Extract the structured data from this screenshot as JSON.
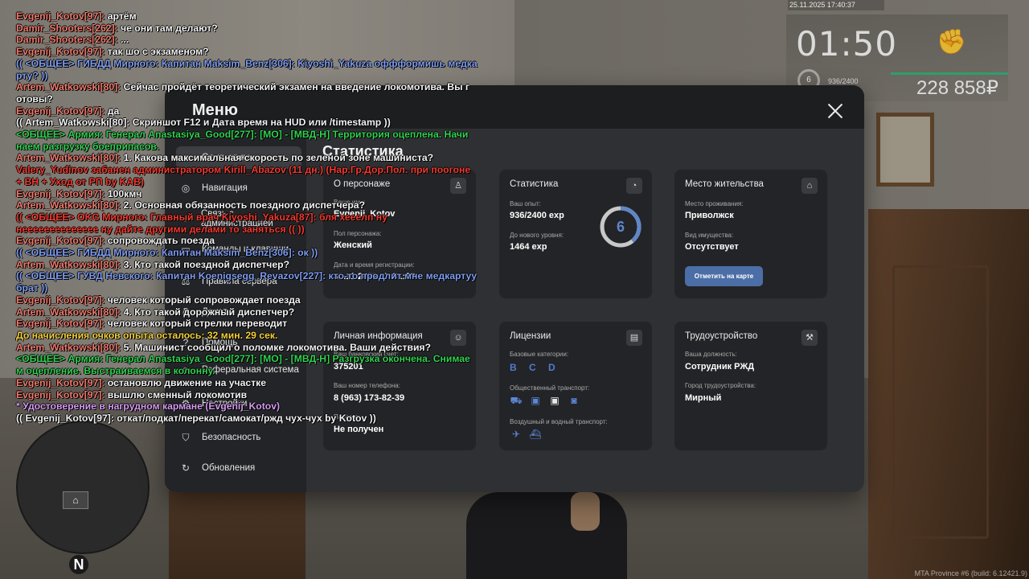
{
  "hud": {
    "datetime": "25.11.2025 17:40:37",
    "time": "01:50",
    "level": "6",
    "exp": "936/2400",
    "money": "228 858₽",
    "build_info": "MTA Province #6 (build: 6.12421.9)"
  },
  "minimap": {
    "north_label": "N"
  },
  "menu": {
    "title": "Меню",
    "main_title": "Статистика",
    "sidebar": [
      {
        "label": "Статистика"
      },
      {
        "label": "Навигация"
      },
      {
        "label": "Связь с администрацией"
      },
      {
        "label": "Команды и клавиши"
      },
      {
        "label": "Правила сервера"
      },
      {
        "label": "Донат"
      },
      {
        "label": "Помощь"
      },
      {
        "label": "Реферальная система"
      },
      {
        "label": "Настройки"
      },
      {
        "label": "Безопасность"
      },
      {
        "label": "Обновления"
      }
    ],
    "cards": {
      "character": {
        "title": "О персонаже",
        "name_label": "Ваше имя:",
        "name_value": "Evgenij_Kotov",
        "gender_label": "Пол персонажа:",
        "gender_value": "Женский",
        "reg_label": "Дата и время регистрации:",
        "reg_value": "30.11.2021 17:31:30"
      },
      "stats": {
        "title": "Статистика",
        "exp_label": "Ваш опыт:",
        "exp_value": "936/2400 exp",
        "next_label": "До нового уровня:",
        "next_value": "1464 exp",
        "level": "6",
        "level_progress": 0.39
      },
      "residence": {
        "title": "Место жительства",
        "place_label": "Место проживания:",
        "place_value": "Приволжск",
        "property_label": "Вид имущества:",
        "property_value": "Отсутствует",
        "button": "Отметить на карте"
      },
      "personal": {
        "title": "Личная информация",
        "bank_label": "Ваш банковский счет:",
        "bank_value": "375201",
        "phone_label": "Ваш номер телефона:",
        "phone_value": "8 (963) 173-82-39",
        "passport_label": "Паспорт:",
        "passport_value": "Не получен"
      },
      "licenses": {
        "title": "Лицензии",
        "base_label": "Базовые категории:",
        "base_value": "B C D",
        "public_label": "Общественный транспорт:",
        "air_label": "Воздушный и водный транспорт:"
      },
      "employment": {
        "title": "Трудоустройство",
        "position_label": "Ваша должность:",
        "position_value": "Сотрудник РЖД",
        "city_label": "Город трудоустройства:",
        "city_value": "Мирный"
      }
    }
  },
  "chat": [
    {
      "name": "Evgenij_Kotov[97]:",
      "text": " артём",
      "color": "red"
    },
    {
      "name": "Damir_Shooters[262]:",
      "text": " че они там делают?",
      "color": "red"
    },
    {
      "name": "Damir_Shooters[262]:",
      "text": " ...",
      "color": "red"
    },
    {
      "name": "Evgenij_Kotov[97]:",
      "text": " так шо с экзаменом?",
      "color": "red"
    },
    {
      "name": "",
      "text": "(( <ОБЩЕЕ> ГИБДД Мирного: Капитан Maksim_Benz[306]: Kiyoshi_Yakuza оффформишь медка",
      "color": "blue"
    },
    {
      "name": "",
      "text": "рту? ))",
      "color": "blue"
    },
    {
      "name": "Artem_Watkowski[80]:",
      "text": " Сейчас пройдёт теоретический экзамен на введение локомотива. Вы г",
      "color": "red"
    },
    {
      "name": "",
      "text": "отовы?",
      "color": "white"
    },
    {
      "name": "Evgenij_Kotov[97]:",
      "text": " да",
      "color": "red"
    },
    {
      "name": "",
      "text": "(( Artem_Watkowski[80]: Скриншот F12 и Дата время на HUD или /timestamp ))",
      "color": "white"
    },
    {
      "name": "",
      "text": "<ОБЩЕЕ> Армия: Генерал Anastasiya_Good[277]: [МО] - [МВД-Н] Территория оцеплена. Начи",
      "color": "green"
    },
    {
      "name": "",
      "text": "наем разгрузку боеприпасов.",
      "color": "green"
    },
    {
      "name": "Artem_Watkowski[80]:",
      "text": " 1. Какова максимальная скорость по зеленой зоне машиниста?",
      "color": "red"
    },
    {
      "name": "",
      "text": "Valery_Yudinov забанен администратором Kirill_Abazov (11 дн.) (Нар.Гр.Дор.Пол. при поогоне",
      "color": "redbright"
    },
    {
      "name": "",
      "text": "+ ВН + Уход от РП by KAB)",
      "color": "redbright"
    },
    {
      "name": "Evgenij_Kotov[97]:",
      "text": " 100кмч",
      "color": "red"
    },
    {
      "name": "Artem_Watkowski[80]:",
      "text": " 2. Основная обязанность поездного диспетчера?",
      "color": "red"
    },
    {
      "name": "",
      "text": "(( <ОБЩЕЕ> OKG Мирного: Главный врач Kiyoshi_Yakuza[87]: бля хееелп ну",
      "color": "redbright"
    },
    {
      "name": "",
      "text": "нееееееееееееее ну дайте другими делами то заняться (( ))",
      "color": "redbright"
    },
    {
      "name": "Evgenij_Kotov[97]:",
      "text": " сопровождать поезда",
      "color": "red"
    },
    {
      "name": "",
      "text": "(( <ОБЩЕЕ> ГИБДД Мирного: Капитан Maksim_Benz[306]: ок ))",
      "color": "blue"
    },
    {
      "name": "Artem_Watkowski[80]:",
      "text": " 3. Кто такой поездной диспетчер?",
      "color": "red"
    },
    {
      "name": "",
      "text": "(( <ОБЩЕЕ> ГУВД Невского: Капитан Koenigsegg_Revazov[227]: кто-то продлит мне медкартуу",
      "color": "blue"
    },
    {
      "name": "",
      "text": " брат ))",
      "color": "blue"
    },
    {
      "name": "Evgenij_Kotov[97]:",
      "text": " человек который сопровождает поезда",
      "color": "red"
    },
    {
      "name": "Artem_Watkowski[80]:",
      "text": " 4. Кто такой дорожный диспетчер?",
      "color": "red"
    },
    {
      "name": "Evgenij_Kotov[97]:",
      "text": " человек который стрелки переводит",
      "color": "red"
    },
    {
      "name": "",
      "text": "До начисления очков опыта осталось: 32 мин. 29 сек.",
      "color": "yellow"
    },
    {
      "name": "Artem_Watkowski[80]:",
      "text": " 5. Машинист сообщил о поломке локомотива. Ваши действия?",
      "color": "red"
    },
    {
      "name": "",
      "text": "<ОБЩЕЕ> Армия: Генерал Anastasiya_Good[277]: [МО] - [МВД-Н] Разгрузка окончена. Снимае",
      "color": "green"
    },
    {
      "name": "",
      "text": "м оцепление. Выстраиваемся в колонну.",
      "color": "green"
    },
    {
      "name": "Evgenij_Kotov[97]:",
      "text": " остановлю движение на участке",
      "color": "red"
    },
    {
      "name": "Evgenij_Kotov[97]:",
      "text": " вышлю сменный локомотив",
      "color": "red"
    },
    {
      "name": "",
      "text": "* Удостоверение в нагрудном кармане (Evgenij_Kotov)",
      "color": "pink"
    },
    {
      "name": "",
      "text": "(( Evgenij_Kotov[97]: откат/подкат/перекат/самокат/ржд чух-чух by Kotov ))",
      "color": "white"
    }
  ],
  "colors": {
    "accent": "#4c6ea6",
    "card_bg": "#232427",
    "window_bg": "#2f3033"
  },
  "icons": {
    "sidebar": [
      "chart-icon",
      "compass-icon",
      "chat-icon",
      "keyboard-icon",
      "scales-icon",
      "ruble-icon",
      "help-icon",
      "people-icon",
      "gear-icon",
      "shield-icon",
      "refresh-icon"
    ]
  }
}
